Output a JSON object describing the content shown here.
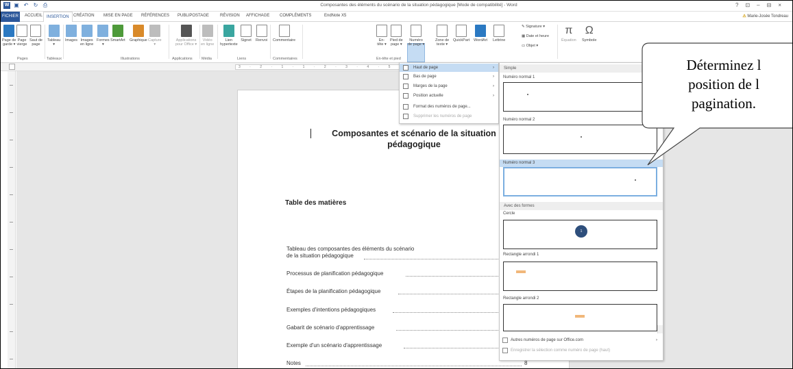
{
  "window": {
    "title": "Composantes des éléments du scénario de la situation pédagogique [Mode de compatibilité] - Word",
    "controls": [
      "?",
      "⊡",
      "–",
      "⊟",
      "×"
    ]
  },
  "tabs": {
    "file": "FICHIER",
    "items": [
      "ACCUEIL",
      "INSERTION",
      "CRÉATION",
      "MISE EN PAGE",
      "RÉFÉRENCES",
      "PUBLIPOSTAGE",
      "RÉVISION",
      "AFFICHAGE",
      "COMPLÉMENTS",
      "EndNote X5"
    ],
    "active": "INSERTION",
    "user": "Marie-Josée Tondreau"
  },
  "ribbon": {
    "buttons": {
      "page_garde": "Page de\ngarde ▾",
      "page_vierge": "Page\nvierge",
      "saut_page": "Saut de\npage",
      "tableau": "Tableau\n▾",
      "images": "Images",
      "images_ligne": "Images\nen ligne",
      "formes": "Formes\n▾",
      "smartart": "SmartArt",
      "graphique": "Graphique",
      "capture": "Capture\n▾",
      "applications": "Applications\npour Office ▾",
      "video": "Vidéo\nen ligne",
      "lien": "Lien\nhypertexte",
      "signet": "Signet",
      "renvoi": "Renvoi",
      "commentaire": "Commentaire",
      "entete": "En-\ntête ▾",
      "pied": "Pied de\npage ▾",
      "numero": "Numéro\nde page ▾",
      "zone_texte": "Zone de\ntexte ▾",
      "quickpart": "QuickPart",
      "wordart": "WordArt",
      "lettrine": "Lettrine",
      "signature": "Signature ▾",
      "date_heure": "Date et heure",
      "objet": "Objet ▾",
      "equation": "Équation",
      "symbole": "Symbole"
    },
    "groups": {
      "pages": "Pages",
      "tableaux": "Tableaux",
      "illustrations": "Illustrations",
      "applications": "Applications",
      "media": "Média",
      "liens": "Liens",
      "commentaires": "Commentaires",
      "entete_pied": "En-tête et pied"
    }
  },
  "menu": {
    "items": [
      {
        "label": "Haut de page",
        "submenu": true,
        "highlighted": true,
        "disabled": false
      },
      {
        "label": "Bas de page",
        "submenu": true,
        "highlighted": false,
        "disabled": false
      },
      {
        "label": "Marges de la page",
        "submenu": true,
        "highlighted": false,
        "disabled": false
      },
      {
        "label": "Position actuelle",
        "submenu": true,
        "highlighted": false,
        "disabled": false
      },
      {
        "label": "Format des numéros de page...",
        "submenu": false,
        "highlighted": false,
        "disabled": false
      },
      {
        "label": "Supprimer les numéros de page",
        "submenu": false,
        "highlighted": false,
        "disabled": true
      }
    ]
  },
  "gallery": {
    "section_simple": "Simple",
    "item1": "Numéro normal 1",
    "item2": "Numéro normal 2",
    "item3": "Numéro normal 3",
    "section_formes": "Avec des formes",
    "cercle": "Cercle",
    "cercle_num": "1",
    "rect1": "Rectangle arrondi 1",
    "rect2": "Rectangle arrondi 2",
    "more": "Autres numéros de page sur Office.com",
    "save": "Enregistrer la sélection comme numéro de page (haut)"
  },
  "document": {
    "heading_line1": "Composantes et scénario de la situation",
    "heading_line2": "pédagogique",
    "toc_title": "Table des matières",
    "toc": [
      {
        "line1": "Tableau des composantes des éléments du scénario",
        "line2": "de la situation pédagogique"
      },
      {
        "line1": "Processus de planification pédagogique"
      },
      {
        "line1": "Étapes de la planification pédagogique"
      },
      {
        "line1": "Exemples d'intentions pédagogiques"
      },
      {
        "line1": "Gabarit de scénario d'apprentissage"
      },
      {
        "line1": "Exemple d'un scénario d'apprentissage"
      },
      {
        "line1": "Notes"
      }
    ],
    "notes_page": "8"
  },
  "ruler": {
    "labels": "3 · 2 · 1 · 1 · 2 · 3 · 4 · 5 · 6 · 7"
  },
  "callout": {
    "line1": "Déterminez l",
    "line2": "position de l",
    "line3": "pagination."
  }
}
